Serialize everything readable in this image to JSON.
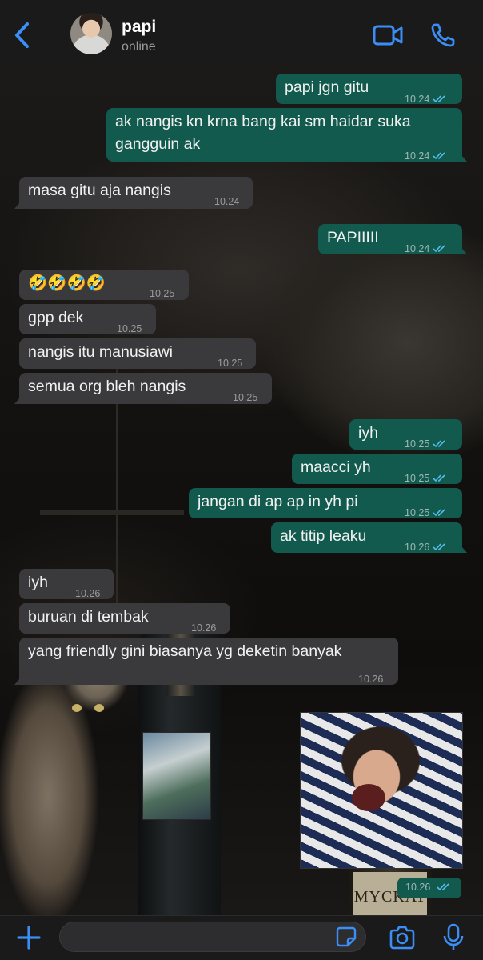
{
  "header": {
    "back_icon": "chevron-left-icon",
    "contact_name": "papi",
    "contact_status": "online",
    "video_icon": "video-camera-icon",
    "call_icon": "phone-icon"
  },
  "colors": {
    "accent": "#3b8ef5",
    "outgoing_bubble": "#115a4d",
    "incoming_bubble": "#3a3a3c",
    "read_ticks": "#53bdeb"
  },
  "messages": [
    {
      "dir": "out",
      "text": "papi jgn gitu",
      "time": "10.24",
      "read": true
    },
    {
      "dir": "out",
      "text": "ak nangis kn krna bang kai sm haidar suka gangguin ak",
      "time": "10.24",
      "read": true
    },
    {
      "dir": "in",
      "text": "masa gitu aja nangis",
      "time": "10.24"
    },
    {
      "dir": "out",
      "text": "PAPIIIII",
      "time": "10.24",
      "read": true
    },
    {
      "dir": "in",
      "text": "🤣🤣🤣🤣",
      "time": "10.25"
    },
    {
      "dir": "in",
      "text": "gpp dek",
      "time": "10.25"
    },
    {
      "dir": "in",
      "text": "nangis itu manusiawi",
      "time": "10.25"
    },
    {
      "dir": "in",
      "text": "semua org bleh nangis",
      "time": "10.25"
    },
    {
      "dir": "out",
      "text": "iyh",
      "time": "10.25",
      "read": true
    },
    {
      "dir": "out",
      "text": "maacci yh",
      "time": "10.25",
      "read": true
    },
    {
      "dir": "out",
      "text": "jangan di ap ap in yh pi",
      "time": "10.25",
      "read": true
    },
    {
      "dir": "out",
      "text": "ak titip leaku",
      "time": "10.26",
      "read": true
    },
    {
      "dir": "in",
      "text": "iyh",
      "time": "10.26"
    },
    {
      "dir": "in",
      "text": "buruan di tembak",
      "time": "10.26"
    },
    {
      "dir": "in",
      "text": "yang friendly gini biasanya yg deketin banyak",
      "time": "10.26"
    }
  ],
  "sticker": {
    "time": "10.26",
    "read": true
  },
  "wallpaper": {
    "bottle_label_text": "MYCKAT"
  },
  "input": {
    "plus_icon": "plus-icon",
    "placeholder": "",
    "sticker_icon": "sticker-icon",
    "camera_icon": "camera-icon",
    "mic_icon": "microphone-icon"
  }
}
